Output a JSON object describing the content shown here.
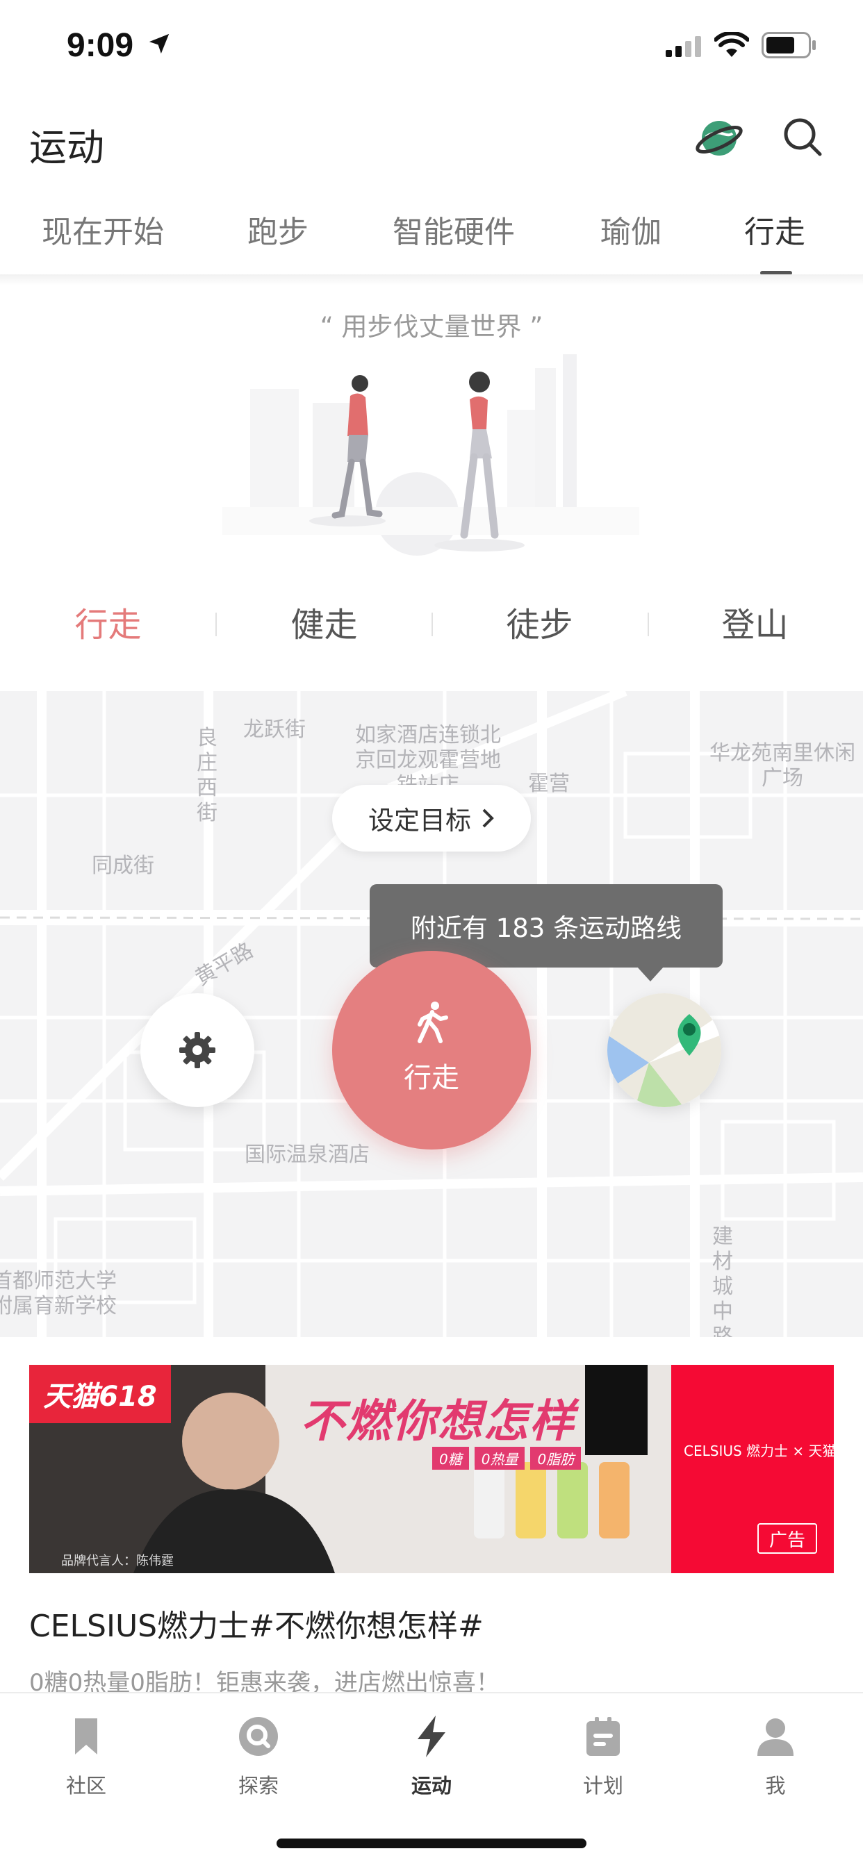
{
  "status_bar": {
    "time": "9:09"
  },
  "header": {
    "title": "运动"
  },
  "tabs": [
    {
      "label": "现在开始"
    },
    {
      "label": "跑步"
    },
    {
      "label": "智能硬件"
    },
    {
      "label": "瑜伽"
    },
    {
      "label": "行走",
      "active": true
    }
  ],
  "hero": {
    "slogan": "“ 用步伐丈量世界 ”"
  },
  "subtabs": [
    {
      "label": "行走",
      "active": true
    },
    {
      "label": "健走"
    },
    {
      "label": "徒步"
    },
    {
      "label": "登山"
    }
  ],
  "map": {
    "labels": {
      "longyue": "龙跃街",
      "liangzhuang": "良庄西街",
      "hotel": "如家酒店连锁北京回龙观霍营地铁站店",
      "huoying": "霍营",
      "hualong": "华龙苑南里休闲广场",
      "tongcheng": "同成街",
      "huangping": "黄平路",
      "spa_hotel": "国际温泉酒店",
      "school": "首都师范大学附属育新学校",
      "jiancai": "建材城中路"
    },
    "goal_button": "设定目标",
    "tooltip": "附近有 183 条运动路线",
    "start_button": "行走"
  },
  "ad": {
    "tmall_tag": "天猫618",
    "headline": "不燃你想怎样",
    "chips": [
      "0糖",
      "0热量",
      "0脂肪"
    ],
    "spokesperson": "品牌代言人：陈伟霆",
    "brand": "CELSIUS 燃力士 × 天猫",
    "badge": "广告",
    "title": "CELSIUS燃力士#不燃你想怎样#",
    "description": "0糖0热量0脂肪！钜惠来袭，进店燃出惊喜！"
  },
  "bottom_nav": [
    {
      "label": "社区",
      "icon": "bookmark-icon"
    },
    {
      "label": "探索",
      "icon": "explore-icon"
    },
    {
      "label": "运动",
      "icon": "lightning-icon",
      "active": true
    },
    {
      "label": "计划",
      "icon": "calendar-icon"
    },
    {
      "label": "我",
      "icon": "person-icon"
    }
  ],
  "colors": {
    "accent": "#e47f80",
    "active_subtab": "#e47a7a",
    "tooltip_bg": "#6d6d6d"
  }
}
